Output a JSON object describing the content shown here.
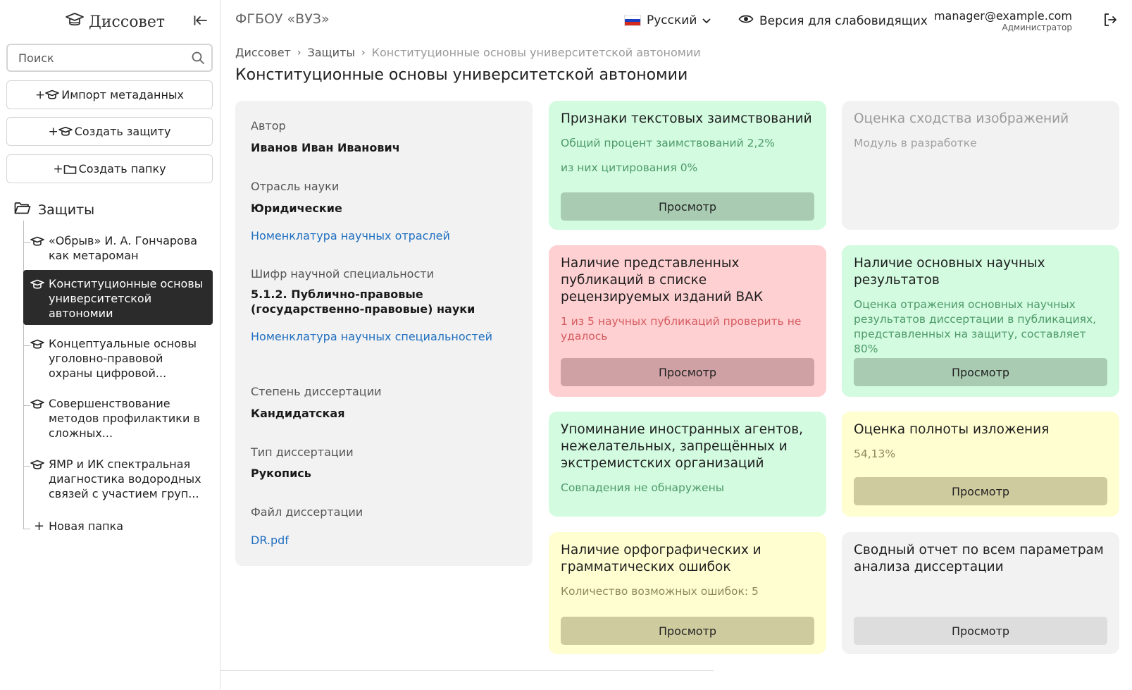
{
  "sidebar": {
    "logo": "Диссовет",
    "search": {
      "placeholder": "Поиск",
      "value": ""
    },
    "buttons": {
      "import": "Импорт метаданных",
      "create_defense": "Создать защиту",
      "create_folder": "Создать папку"
    },
    "tree_root": "Защиты",
    "items": [
      {
        "label": "«Обрыв» И. А. Гончарова как метароман"
      },
      {
        "label": "Конституционные основы университетской автономии"
      },
      {
        "label": "Концептуальные основы уголовно-правовой охраны цифровой..."
      },
      {
        "label": "Совершенствование методов профилактики в сложных..."
      },
      {
        "label": "ЯМР и ИК спектральная диагностика водородных связей с участием груп..."
      }
    ],
    "new_folder": "Новая папка"
  },
  "header": {
    "org": "ФГБОУ «ВУЗ»",
    "language": "Русский",
    "accessibility": "Версия для слабовидящих",
    "user_email": "manager@example.com",
    "user_role": "Администратор"
  },
  "breadcrumb": [
    "Диссовет",
    "Защиты",
    "Конституционные основы университетской автономии"
  ],
  "page_title": "Конституционные основы университетской автономии",
  "info": {
    "author_label": "Автор",
    "author": "Иванов Иван Иванович",
    "branch_label": "Отрасль науки",
    "branch": "Юридические",
    "branch_link": "Номенклатура научных отраслей",
    "code_label": "Шифр научной специальности",
    "code": "5.1.2. Публично-правовые (государственно-правовые) науки",
    "code_link": "Номенклатура научных специальностей",
    "degree_label": "Степень диссертации",
    "degree": "Кандидатская",
    "type_label": "Тип диссертации",
    "type": "Рукопись",
    "file_label": "Файл диссертации",
    "file": "DR.pdf"
  },
  "cards": {
    "view_label": "Просмотр",
    "borrowings": {
      "title": "Признаки текстовых заимствований",
      "line1": "Общий процент заимствований 2,2%",
      "line2": "из них цитирования 0%"
    },
    "images": {
      "title": "Оценка сходства изображений",
      "text": "Модуль в разработке"
    },
    "vak": {
      "title": "Наличие представленных публикаций в списке рецензируемых изданий ВАК",
      "text": "1 из 5 научных публикаций проверить не удалось"
    },
    "results": {
      "title": "Наличие основных научных результатов",
      "text": "Оценка отражения основных научных результатов диссертации в публикациях, представленных на защиту, составляет 80%"
    },
    "agents": {
      "title": "Упоминание иностранных агентов, нежелательных, запрещённых и экстремистских организаций",
      "text": "Совпадения не обнаружены"
    },
    "completeness": {
      "title": "Оценка полноты изложения",
      "text": "54,13%"
    },
    "spelling": {
      "title": "Наличие орфографических и грамматических ошибок",
      "text": "Количество возможных ошибок: 5"
    },
    "summary": {
      "title": "Сводный отчет по всем параметрам анализа диссертации"
    }
  },
  "colors": {
    "green_bg": "#d2fbe0",
    "red_bg": "#ffd0d2",
    "yellow_bg": "#fffed0",
    "gray_bg": "#f2f2f2",
    "active_item": "#2b2b2b",
    "link": "#1f6fc0"
  }
}
